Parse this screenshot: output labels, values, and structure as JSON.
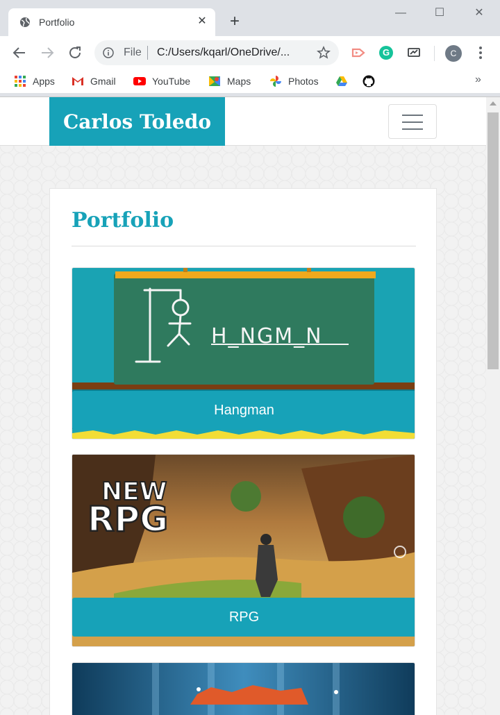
{
  "browser": {
    "tab_title": "Portfolio",
    "omnibox": {
      "scheme_label": "File",
      "url": "C:/Users/kqarl/OneDrive/..."
    },
    "profile_initial": "C",
    "extension_grammarly_letter": "G",
    "bookmarks": [
      {
        "label": "Apps",
        "icon": "apps-grid-icon"
      },
      {
        "label": "Gmail",
        "icon": "gmail-icon"
      },
      {
        "label": "YouTube",
        "icon": "youtube-icon"
      },
      {
        "label": "Maps",
        "icon": "maps-icon"
      },
      {
        "label": "Photos",
        "icon": "photos-icon"
      },
      {
        "label": "",
        "icon": "google-drive-icon"
      },
      {
        "label": "",
        "icon": "github-icon"
      }
    ],
    "bookmarks_overflow": "»"
  },
  "site": {
    "brand": "Carlos Toledo",
    "section_title": "Portfolio",
    "projects": [
      {
        "label": "Hangman",
        "board_text": "H_NGM_N"
      },
      {
        "label": "RPG",
        "logo_top": "NEW",
        "logo_bottom": "RPG"
      },
      {
        "label": ""
      }
    ]
  },
  "colors": {
    "accent": "#17a2b8",
    "chalkboard": "#2f7a5e",
    "chrome_bg": "#dee1e6"
  }
}
